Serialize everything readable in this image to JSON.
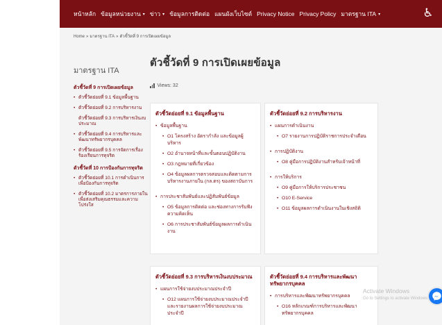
{
  "topnav": {
    "items": [
      {
        "label": "หน้าหลัก",
        "dropdown": false
      },
      {
        "label": "ข้อมูลหน่วยงาน",
        "dropdown": true
      },
      {
        "label": "ข่าว",
        "dropdown": true
      },
      {
        "label": "ข้อมูลการติดต่อ",
        "dropdown": false
      },
      {
        "label": "แผนผังเว็บไซต์",
        "dropdown": false
      },
      {
        "label": "Privacy Notice",
        "dropdown": false
      },
      {
        "label": "Privacy Policy",
        "dropdown": false
      },
      {
        "label": "มาตรฐาน ITA",
        "dropdown": true
      }
    ],
    "caret": "▾",
    "accessibility_icon": "accessibility-icon",
    "accessibility_glyph": "♿",
    "bar_color": "#7a0f14"
  },
  "breadcrumb": {
    "home": "Home",
    "parent": "มาตรฐาน ITA",
    "current": "ตัวชี้วัดที่ 9 การเปิดเผยข้อมูล",
    "separator": "»"
  },
  "sidebar": {
    "title": "มาตรฐาน ITA",
    "groups": [
      {
        "title": "ตัวชี้วัดที่ 9 การเปิดเผยข้อมูล",
        "links": [
          "ตัวชี้วัดย่อยที่ 9.1 ข้อมูลพื้นฐาน",
          "ตัวชี้วัดย่อยที่ 9.2 การบริหารงาน",
          "ตัวชี้วัดย่อยที่ 9.3 การบริหารเงินงบประมาณ",
          "ตัวชี้วัดย่อยที่ 9.4 การบริหารและพัฒนาทรัพยากรบุคคล",
          "ตัวชี้วัดย่อยที่ 9.5 การจัดการเรื่องร้องเรียนการทุจริต"
        ]
      },
      {
        "title": "ตัวชี้วัดที่ 10 การป้องกันการทุจริต",
        "links": [
          "ตัวชี้วัดย่อยที่ 10.1 การดำเนินการเพื่อป้องกันการทุจริต",
          "ตัวชี้วัดย่อยที่ 10.2 มาตรการภายในเพื่อส่งเสริมคุณธรรมและความโปร่งใส"
        ]
      }
    ]
  },
  "main": {
    "title": "ตัวชี้วัดที่ 9 การเปิดเผยข้อมูล",
    "views_label": "Views: 32",
    "views_icon": "bar-chart-icon"
  },
  "cards": {
    "c1": {
      "title": "ตัวชี้วัดย่อยที่ 9.1 ข้อมูลพื้นฐาน",
      "g1": "ข้อมูลพื้นฐาน",
      "g1_items": [
        "O1 โครงสร้าง อัตรากำลัง และข้อมูลผู้บริหาร",
        "O2 อำนาจหน้าที่และขั้นตอนปฏิบัติงาน",
        "O3 กฎหมายที่เกี่ยวข้อง",
        "O4 ข้อมูลผลการตรวจสอบและติดตามการบริหารงานภายใน (กล.ตร) ของสถาบันการ"
      ],
      "g2": "การประชาสัมพันธ์และปฏิสัมพันธ์ข้อมูล",
      "g2_items": [
        "O5 ข้อมูลการติดต่อ และช่องทางการรับฟังความคิดเห็น",
        "O6 การประชาสัมพันธ์ข้อมูลผลการดำเนินงาน"
      ]
    },
    "c2": {
      "title": "ตัวชี้วัดย่อยที่ 9.2 การบริหารงาน",
      "g1": "แผนการดำเนินงาน",
      "g1_items": [
        "O7 รายงานการปฏิบัติราชการประจำเดือน"
      ],
      "g2": "การปฏิบัติงาน",
      "g2_items": [
        "O8 คู่มือการปฏิบัติงานสำหรับเจ้าหน้าที่"
      ],
      "g3": "การให้บริการ",
      "g3_items": [
        "O9 คู่มือการให้บริการประชาชน",
        "O10 E-Service",
        "O11 ข้อมูลผลการดำเนินงานในเชิงสถิติ"
      ]
    },
    "c3": {
      "title": "ตัวชี้วัดย่อยที่ 9.3 การบริหารเงินงบประมาณ",
      "g1": "แผนการใช้จ่ายงบประมาณประจำปี",
      "g1_items": [
        "O12 แผนการใช้จ่ายงบประมาณประจำปี และรายงานผลการใช้จ่ายงบประมาณประจำปี"
      ]
    },
    "c4": {
      "title": "ตัวชี้วัดย่อยที่ 9.4 การบริหารและพัฒนาทรัพยากรบุคคล",
      "g1": "การบริหารและพัฒนาทรัพยากรบุคคล",
      "g1_items": [
        "O16 หลักเกณฑ์การบริหารและพัฒนาทรัพยากรบุคคล"
      ]
    }
  },
  "watermark": {
    "line1": "Activate Windows",
    "line2": "Go to Settings to activate Windows."
  },
  "messenger_icon": "messenger-icon",
  "colors": {
    "brand": "#7a0f14",
    "messenger": "#1877f2"
  }
}
